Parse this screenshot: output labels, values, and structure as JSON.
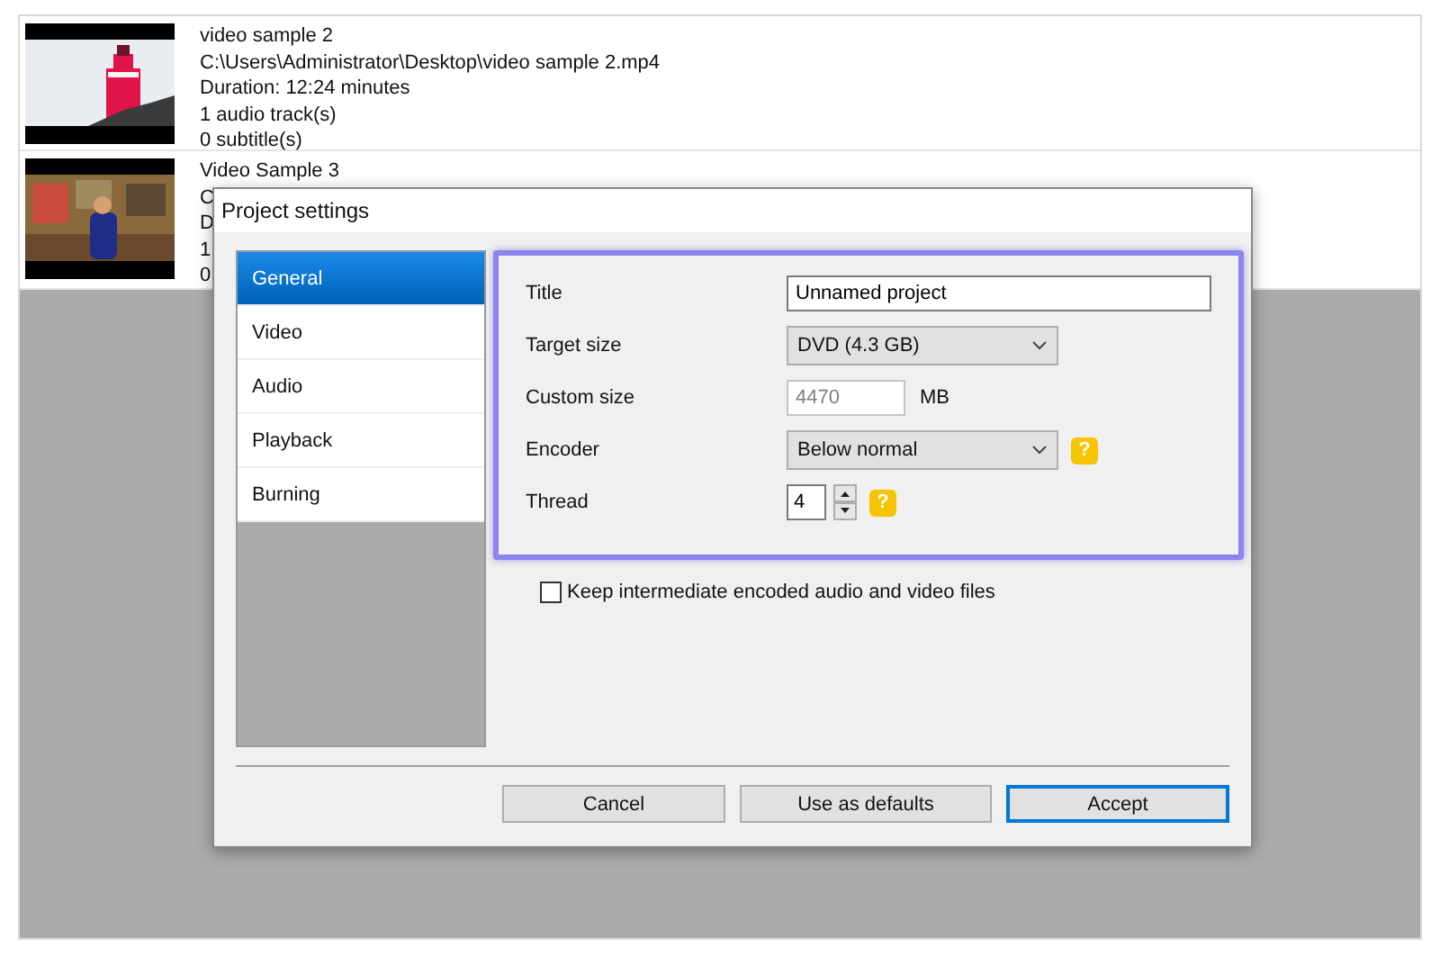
{
  "videos": [
    {
      "title": "video sample 2",
      "lines": [
        "C:\\Users\\Administrator\\Desktop\\video sample 2.mp4",
        "Duration: 12:24 minutes",
        "1 audio track(s)",
        "0 subtitle(s)"
      ]
    },
    {
      "title": "Video Sample 3",
      "lines": [
        "C",
        "D",
        "1",
        "0"
      ]
    }
  ],
  "dialog": {
    "title": "Project settings",
    "nav": [
      {
        "label": "General",
        "selected": true
      },
      {
        "label": "Video",
        "selected": false
      },
      {
        "label": "Audio",
        "selected": false
      },
      {
        "label": "Playback",
        "selected": false
      },
      {
        "label": "Burning",
        "selected": false
      }
    ],
    "fields": [
      {
        "kind": "text",
        "label": "Title",
        "value": "Unnamed project",
        "disabled": false
      },
      {
        "kind": "select",
        "label": "Target size",
        "value": "DVD (4.3 GB)"
      },
      {
        "kind": "number",
        "label": "Custom size",
        "value": "4470",
        "disabled": true,
        "unit": "MB"
      },
      {
        "kind": "select",
        "label": "Encoder",
        "value": "Below normal",
        "help": "?"
      },
      {
        "kind": "spin",
        "label": "Thread",
        "value": "4",
        "help": "?"
      }
    ],
    "option": {
      "label": "Keep intermediate encoded audio and video files",
      "checked": false
    },
    "buttons": [
      {
        "label": "Cancel",
        "default": false
      },
      {
        "label": "Use as defaults",
        "default": false
      },
      {
        "label": "Accept",
        "default": true
      }
    ]
  }
}
